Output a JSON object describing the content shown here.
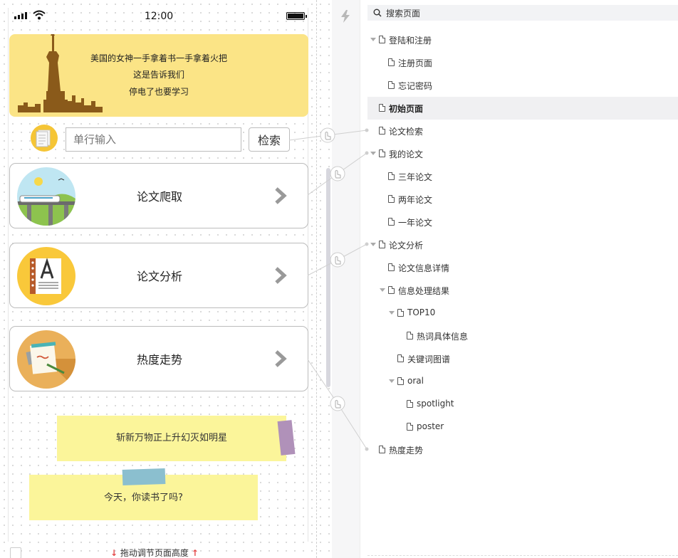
{
  "status_bar": {
    "time": "12:00"
  },
  "banner": {
    "lines": [
      "美国的女神一手拿着书一手拿着火把",
      "这是告诉我们",
      "停电了也要学习"
    ]
  },
  "search": {
    "placeholder": "单行输入",
    "button_label": "检索"
  },
  "cards": [
    {
      "label": "论文爬取",
      "icon": "train-landscape-icon"
    },
    {
      "label": "论文分析",
      "icon": "notebook-letter-a-icon"
    },
    {
      "label": "热度走势",
      "icon": "notepad-pencil-icon"
    }
  ],
  "notes": [
    "斩新万物正上升幻灭如明星",
    "今天，你读书了吗?"
  ],
  "resize_hint": "拖动调节页面高度",
  "pages_panel": {
    "search_label": "搜索页面",
    "tree": [
      {
        "label": "登陆和注册",
        "level": 0,
        "caret": true,
        "selected": false
      },
      {
        "label": "注册页面",
        "level": 1,
        "caret": false,
        "selected": false
      },
      {
        "label": "忘记密码",
        "level": 1,
        "caret": false,
        "selected": false
      },
      {
        "label": "初始页面",
        "level": 0,
        "caret": false,
        "selected": true
      },
      {
        "label": "论文检索",
        "level": 0,
        "caret": false,
        "selected": false
      },
      {
        "label": "我的论文",
        "level": 0,
        "caret": true,
        "selected": false
      },
      {
        "label": "三年论文",
        "level": 1,
        "caret": false,
        "selected": false
      },
      {
        "label": "两年论文",
        "level": 1,
        "caret": false,
        "selected": false
      },
      {
        "label": "一年论文",
        "level": 1,
        "caret": false,
        "selected": false
      },
      {
        "label": "论文分析",
        "level": 0,
        "caret": true,
        "selected": false
      },
      {
        "label": "论文信息详情",
        "level": 1,
        "caret": false,
        "selected": false
      },
      {
        "label": "信息处理结果",
        "level": 1,
        "caret": true,
        "selected": false
      },
      {
        "label": "TOP10",
        "level": 2,
        "caret": true,
        "selected": false
      },
      {
        "label": "热词具体信息",
        "level": 3,
        "caret": false,
        "selected": false
      },
      {
        "label": "关键词图谱",
        "level": 2,
        "caret": false,
        "selected": false
      },
      {
        "label": "oral",
        "level": 2,
        "caret": true,
        "selected": false
      },
      {
        "label": "spotlight",
        "level": 3,
        "caret": false,
        "selected": false
      },
      {
        "label": "poster",
        "level": 3,
        "caret": false,
        "selected": false
      },
      {
        "label": "热度走势",
        "level": 0,
        "caret": false,
        "selected": false
      }
    ]
  },
  "colors": {
    "banner_bg": "#fbe486",
    "note_bg": "#fbf59a",
    "tape_purple": "#b091b9",
    "tape_blue": "#8bbfcf",
    "hint_arrow": "#e34a4a",
    "selected_row": "#f0f0f2"
  }
}
